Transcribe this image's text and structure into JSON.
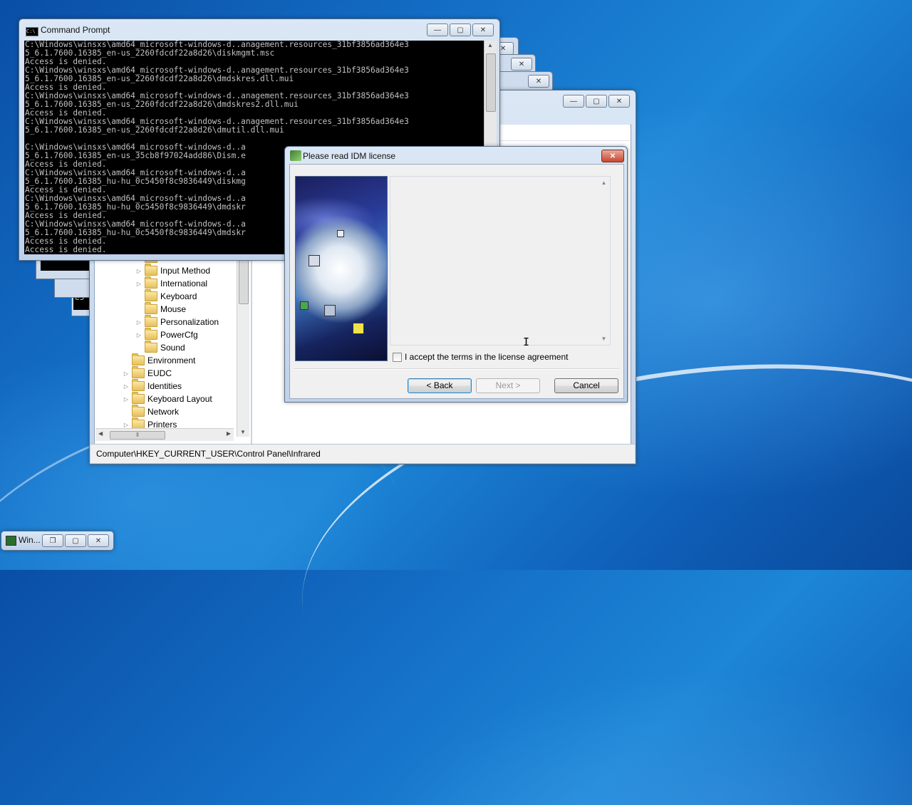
{
  "cmd": {
    "title": "Command Prompt",
    "console_lines": [
      "C:\\Windows\\winsxs\\amd64_microsoft-windows-d..anagement.resources_31bf3856ad364e3",
      "5_6.1.7600.16385_en-us_2260fdcdf22a8d26\\diskmgmt.msc",
      "Access is denied.",
      "C:\\Windows\\winsxs\\amd64_microsoft-windows-d..anagement.resources_31bf3856ad364e3",
      "5_6.1.7600.16385_en-us_2260fdcdf22a8d26\\dmdskres.dll.mui",
      "Access is denied.",
      "C:\\Windows\\winsxs\\amd64_microsoft-windows-d..anagement.resources_31bf3856ad364e3",
      "5_6.1.7600.16385_en-us_2260fdcdf22a8d26\\dmdskres2.dll.mui",
      "Access is denied.",
      "C:\\Windows\\winsxs\\amd64_microsoft-windows-d..anagement.resources_31bf3856ad364e3",
      "5_6.1.7600.16385_en-us_2260fdcdf22a8d26\\dmutil.dll.mui",
      "",
      "C:\\Windows\\winsxs\\amd64_microsoft-windows-d..a",
      "5_6.1.7600.16385_en-us_35cb8f97024add86\\Dism.e",
      "Access is denied.",
      "C:\\Windows\\winsxs\\amd64_microsoft-windows-d..a",
      "5_6.1.7600.16385_hu-hu_0c5450f8c9836449\\diskmg",
      "Access is denied.",
      "C:\\Windows\\winsxs\\amd64_microsoft-windows-d..a",
      "5_6.1.7600.16385_hu-hu_0c5450f8c9836449\\dmdskr",
      "Access is denied.",
      "C:\\Windows\\winsxs\\amd64_microsoft-windows-d..a",
      "5_6.1.7600.16385_hu-hu_0c5450f8c9836449\\dmdskr",
      "Access is denied.",
      "Access is denied."
    ]
  },
  "stacked_cmd": {
    "partial_text_1": "Ac",
    "partial_text_2": "C:",
    "partial_text_3": "e3"
  },
  "regedit": {
    "tree_items": [
      {
        "label": "Infrared",
        "indent": 2,
        "expander": "▷"
      },
      {
        "label": "Input Method",
        "indent": 2,
        "expander": "▷"
      },
      {
        "label": "International",
        "indent": 2,
        "expander": "▷"
      },
      {
        "label": "Keyboard",
        "indent": 2,
        "expander": ""
      },
      {
        "label": "Mouse",
        "indent": 2,
        "expander": ""
      },
      {
        "label": "Personalization",
        "indent": 2,
        "expander": "▷"
      },
      {
        "label": "PowerCfg",
        "indent": 2,
        "expander": "▷"
      },
      {
        "label": "Sound",
        "indent": 2,
        "expander": ""
      },
      {
        "label": "Environment",
        "indent": 1,
        "expander": ""
      },
      {
        "label": "EUDC",
        "indent": 1,
        "expander": "▷"
      },
      {
        "label": "Identities",
        "indent": 1,
        "expander": "▷"
      },
      {
        "label": "Keyboard Layout",
        "indent": 1,
        "expander": "▷"
      },
      {
        "label": "Network",
        "indent": 1,
        "expander": ""
      },
      {
        "label": "Printers",
        "indent": 1,
        "expander": "▷"
      }
    ],
    "status_path": "Computer\\HKEY_CURRENT_USER\\Control Panel\\Infrared"
  },
  "idm": {
    "title": "Please read IDM license",
    "accept_label": "I accept the terms in the license agreement",
    "accept_checked": false,
    "back_label": "< Back",
    "next_label": "Next >",
    "cancel_label": "Cancel"
  },
  "minimized": {
    "title": "Win..."
  },
  "caption": {
    "minimize": "—",
    "maximize": "▢",
    "close": "✕",
    "restore": "❐"
  }
}
